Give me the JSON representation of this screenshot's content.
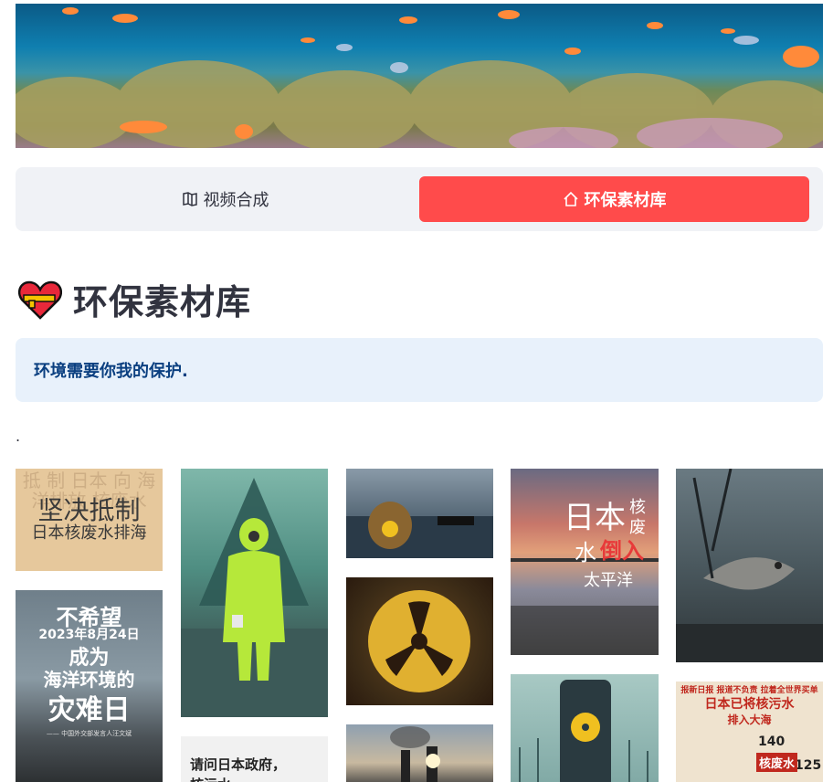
{
  "tabs": {
    "video_label": "视频合成",
    "library_label": "环保素材库",
    "active": "环保素材库"
  },
  "page": {
    "title": "环保素材库",
    "info_text": "环境需要你我的保护.",
    "separator": "."
  },
  "gallery": {
    "tile_1a": {
      "big": "坚决抵制",
      "small": "日本核废水排海",
      "faint": "抵 制 日本 向 海洋排放 核废水"
    },
    "tile_1b": {
      "line1": "不希望",
      "line2": "2023年8月24日",
      "line3": "成为",
      "line4": "海洋环境的",
      "line5": "灾难日",
      "footer": "—— 中国外交部发言人汪文斌"
    },
    "tile_2b": {
      "line1": "请问日本政府，",
      "line2": "核污水"
    },
    "tile_4a": {
      "line1": "日本",
      "line2": "核",
      "line3": "废",
      "line4": "水",
      "line5": "倒入",
      "line6": "太平洋"
    },
    "tile_5b": {
      "top": "报新日报 报道不负责 拉着全世界买单",
      "headline": "日本已将核污水",
      "sub": "排入大海",
      "num1": "140",
      "num2": "125",
      "tag": "核废水"
    }
  },
  "colors": {
    "accent": "#ff4b4b",
    "info_bg": "#e8f1fb",
    "info_text": "#0a3f80",
    "tabs_bg": "#f0f2f6"
  }
}
